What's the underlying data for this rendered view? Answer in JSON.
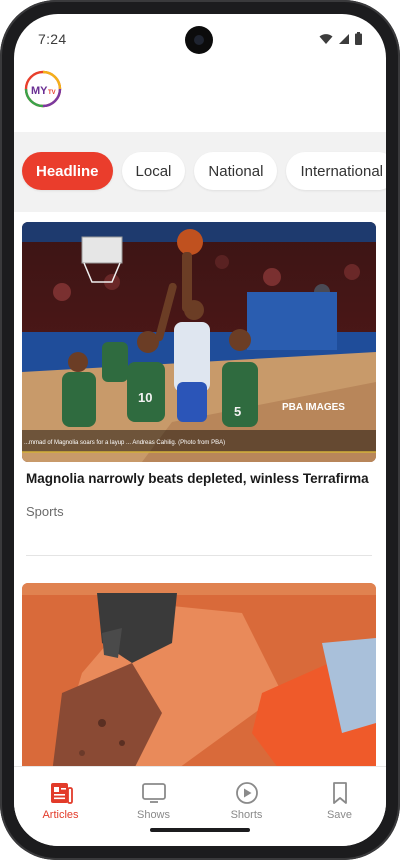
{
  "status": {
    "time": "7:24"
  },
  "colors": {
    "accent": "#ea3d2c",
    "nav_active": "#e23b2a",
    "chip_bg": "#f2f2f2"
  },
  "logo": {
    "text": "MYTV",
    "icon": "mytv-logo"
  },
  "categories": [
    {
      "label": "Headline",
      "active": true
    },
    {
      "label": "Local",
      "active": false
    },
    {
      "label": "National",
      "active": false
    },
    {
      "label": "International",
      "active": false
    }
  ],
  "articles": [
    {
      "title": "Magnolia narrowly beats depleted, winless Terrafirma",
      "category": "Sports",
      "image_caption": "...mmad of Magnolia soars for a layup ... Andreas Cahilig. (Photo from PBA)",
      "image_watermark": "PBA IMAGES",
      "jersey_numbers": [
        "10",
        "5"
      ]
    },
    {
      "title": "",
      "category": ""
    }
  ],
  "bottom_nav": [
    {
      "label": "Articles",
      "icon": "articles-icon",
      "active": true
    },
    {
      "label": "Shows",
      "icon": "tv-icon",
      "active": false
    },
    {
      "label": "Shorts",
      "icon": "play-circle-icon",
      "active": false
    },
    {
      "label": "Save",
      "icon": "bookmark-icon",
      "active": false
    }
  ]
}
